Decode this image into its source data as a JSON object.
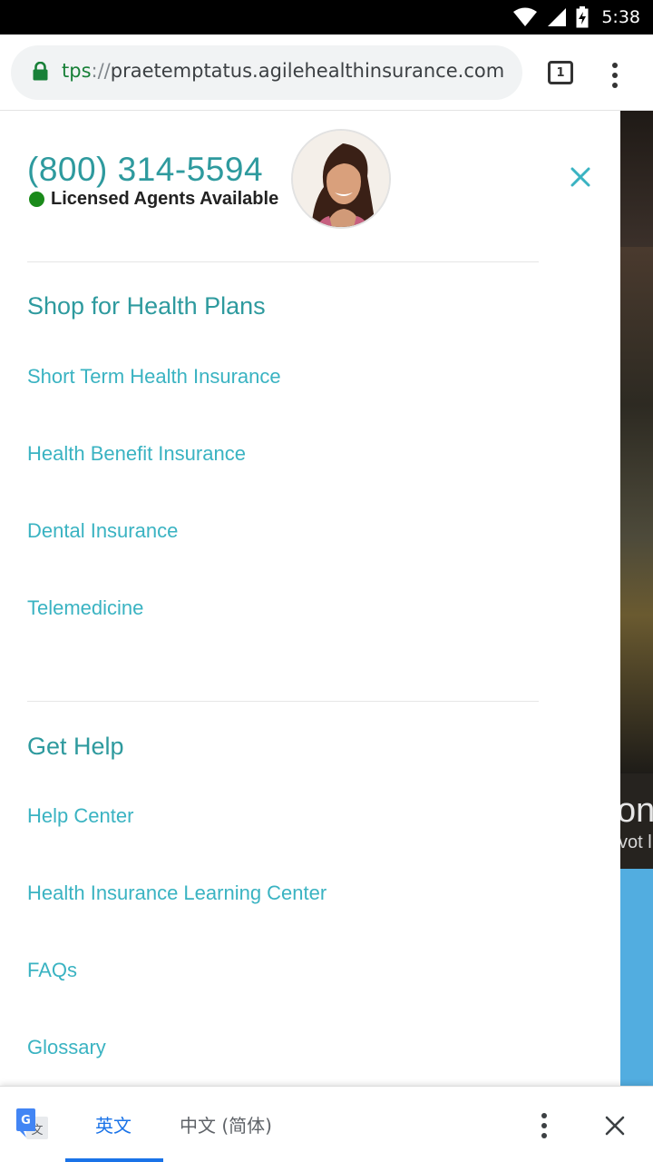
{
  "status_bar": {
    "time": "5:38",
    "icons": [
      "wifi-icon",
      "cell-signal-icon",
      "battery-charging-icon"
    ]
  },
  "browser": {
    "url_scheme": "tps",
    "url_separator": "://",
    "url_host": "praetemptatus.agilehealthinsurance.com",
    "tab_count": "1",
    "icons": [
      "lock-icon",
      "tab-switcher-icon",
      "overflow-menu-icon"
    ]
  },
  "background_page": {
    "text_fragment_1": "on",
    "text_fragment_2": "vot l"
  },
  "drawer": {
    "phone": "(800) 314-5594",
    "agents_status": "Licensed Agents Available",
    "status_color": "#1a8a1a",
    "sections": [
      {
        "title": "Shop for Health Plans",
        "links": [
          "Short Term Health Insurance",
          "Health Benefit Insurance",
          "Dental Insurance",
          "Telemedicine"
        ]
      },
      {
        "title": "Get Help",
        "links": [
          "Help Center",
          "Health Insurance Learning Center",
          "FAQs",
          "Glossary"
        ]
      }
    ]
  },
  "translate_bar": {
    "source_lang": "英文",
    "target_lang": "中文 (简体)",
    "active_tab": "英文",
    "icons": [
      "google-translate-icon",
      "overflow-menu-icon",
      "close-icon"
    ]
  },
  "colors": {
    "accent_teal": "#2e9a9e",
    "link_teal": "#3ab3c2",
    "translate_blue": "#1a73e8"
  }
}
